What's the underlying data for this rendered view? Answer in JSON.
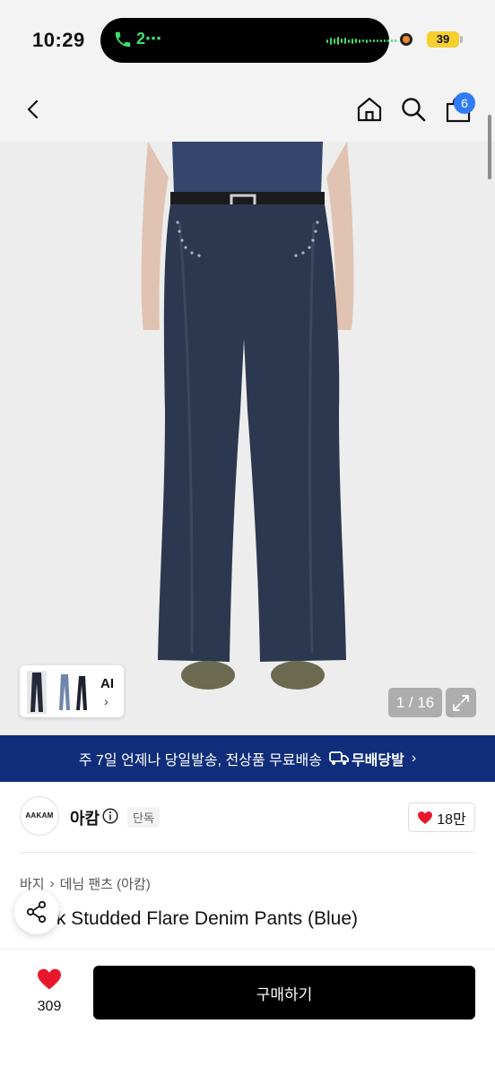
{
  "status_bar": {
    "time": "10:29",
    "call_text": "2⋯",
    "battery": "39"
  },
  "nav": {
    "cart_count": "6"
  },
  "gallery": {
    "thumb_label": "AI",
    "page_counter": "1 / 16"
  },
  "banner": {
    "text": "주 7일 언제나 당일발송, 전상품 무료배송",
    "logo_text": "무배당발"
  },
  "brand": {
    "logo_text": "AAKAM",
    "name": "아캄",
    "tag": "단독",
    "likes": "18만"
  },
  "breadcrumb": {
    "category": "바지",
    "subcategory": "데님 팬츠 (아캄)"
  },
  "product": {
    "title": "Black Studded Flare Denim Pants (Blue)"
  },
  "bottom": {
    "wish_count": "309",
    "buy_label": "구매하기"
  },
  "colors": {
    "banner_bg": "#0f2d7a",
    "heart": "#e8172c",
    "badge": "#2f7cf6",
    "buy_bg": "#000000"
  }
}
